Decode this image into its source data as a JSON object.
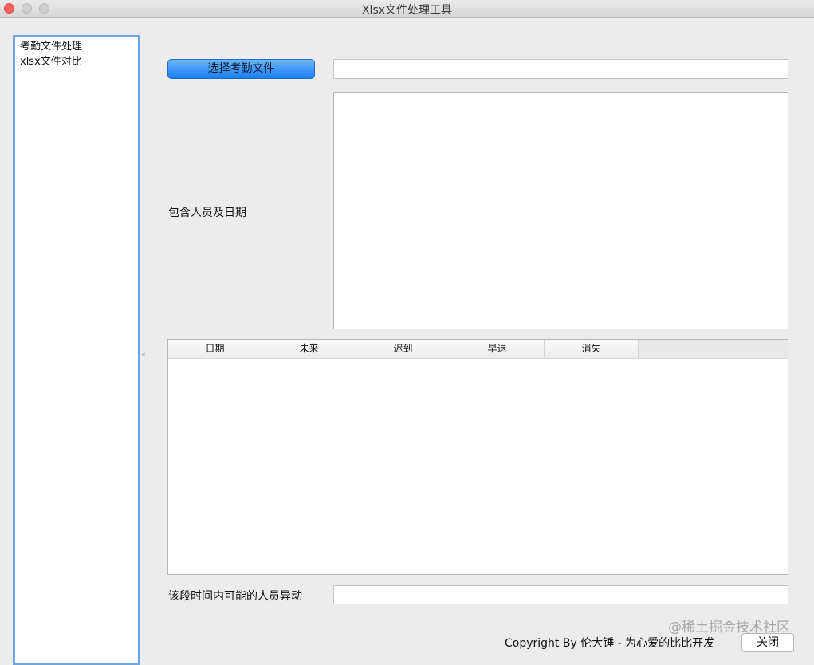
{
  "window": {
    "title": "Xlsx文件处理工具"
  },
  "sidebar": {
    "items": [
      {
        "label": "考勤文件处理"
      },
      {
        "label": "xlsx文件对比"
      }
    ]
  },
  "form": {
    "select_button_label": "选择考勤文件",
    "file_path_value": "",
    "people_dates_label": "包含人员及日期",
    "people_dates_value": "",
    "changes_label": "该段时间内可能的人员异动",
    "changes_value": ""
  },
  "table": {
    "columns": [
      "日期",
      "未来",
      "迟到",
      "早退",
      "消失"
    ],
    "rows": []
  },
  "footer": {
    "copyright": "Copyright By 伦大锤 - 为心爱的比比开发",
    "close_label": "关闭"
  },
  "watermark": {
    "text": "@稀土掘金技术社区"
  },
  "colors": {
    "accent": "#1a7ef1",
    "sidebar_border": "#6da6e6",
    "close_light": "#fc605c"
  },
  "icons": {
    "splitter": "splitter-handle-icon"
  }
}
